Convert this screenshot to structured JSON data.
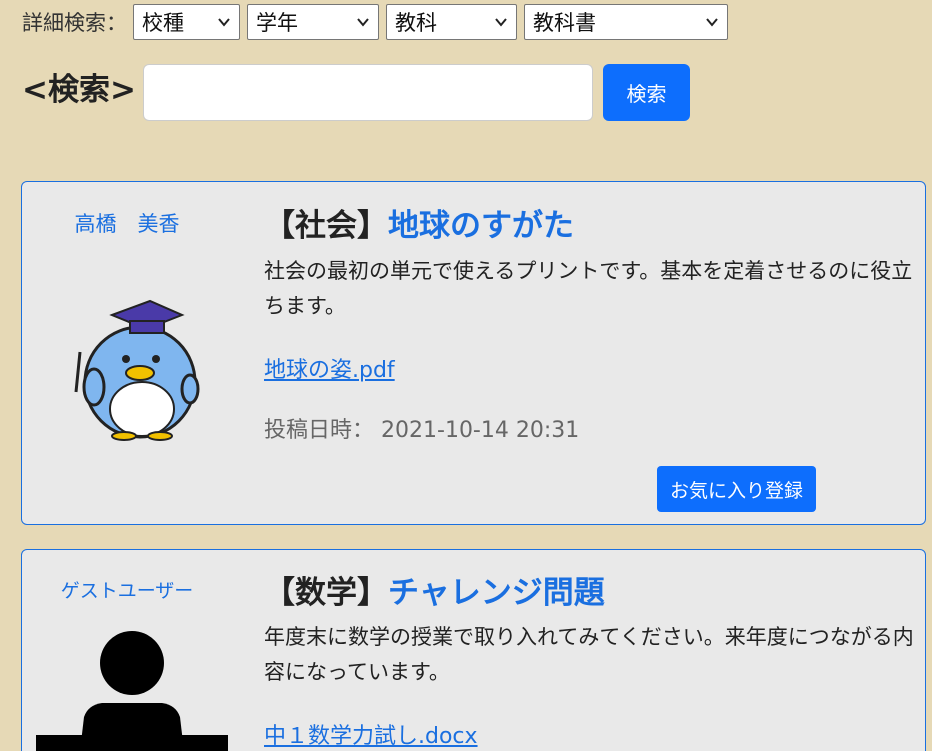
{
  "filters": {
    "label": "詳細検索：",
    "selects": [
      {
        "value": "校種"
      },
      {
        "value": "学年"
      },
      {
        "value": "教科"
      },
      {
        "value": "教科書"
      }
    ]
  },
  "search": {
    "title": "<検索>",
    "input_value": "",
    "button_label": "検索"
  },
  "posts": [
    {
      "author": "高橋　美香",
      "subject": "【社会】",
      "title": "地球のすがた",
      "description": "社会の最初の単元で使えるプリントです。基本を定着させるのに役立ちます。",
      "file": "地球の姿.pdf",
      "posted_label": "投稿日時：",
      "posted_at": "2021-10-14 20:31",
      "favorite_label": "お気に入り登録"
    },
    {
      "author": "ゲストユーザー",
      "subject": "【数学】",
      "title": "チャレンジ問題",
      "description": "年度末に数学の授業で取り入れてみてください。来年度につながる内容になっています。",
      "file": "中１数学力試し.docx"
    }
  ]
}
